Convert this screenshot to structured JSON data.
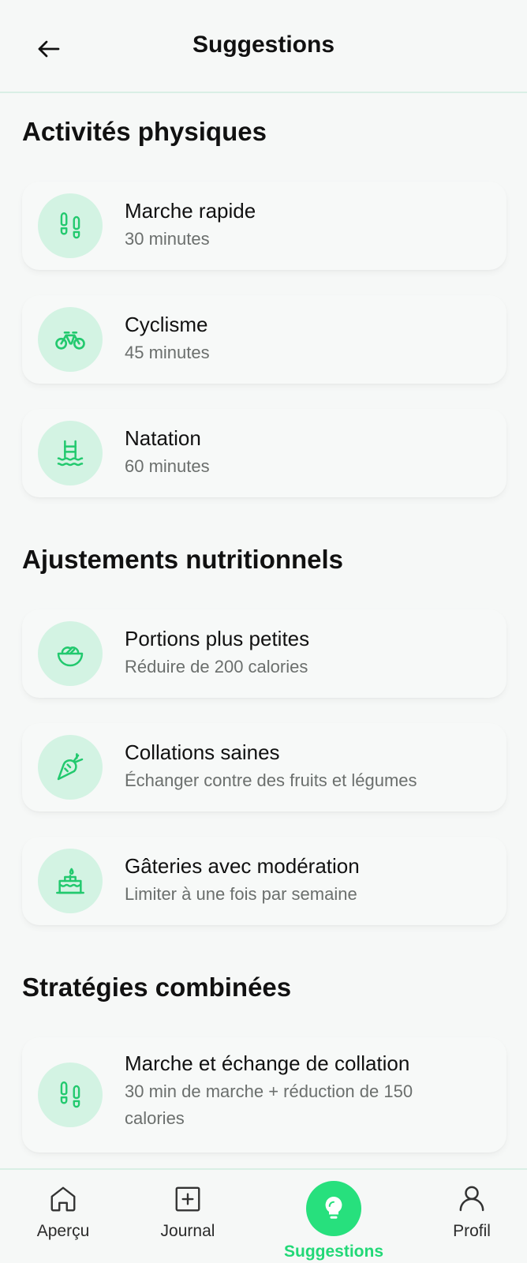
{
  "header": {
    "title": "Suggestions",
    "back_icon": "arrow-left-icon"
  },
  "sections": [
    {
      "title": "Activités physiques",
      "items": [
        {
          "icon": "footprints-icon",
          "title": "Marche rapide",
          "subtitle": "30 minutes"
        },
        {
          "icon": "bicycle-icon",
          "title": "Cyclisme",
          "subtitle": "45 minutes"
        },
        {
          "icon": "pool-icon",
          "title": "Natation",
          "subtitle": "60 minutes"
        }
      ]
    },
    {
      "title": "Ajustements nutritionnels",
      "items": [
        {
          "icon": "salad-bowl-icon",
          "title": "Portions plus petites",
          "subtitle": "Réduire de 200 calories"
        },
        {
          "icon": "carrot-icon",
          "title": "Collations saines",
          "subtitle": "Échanger contre des fruits et légumes"
        },
        {
          "icon": "cake-icon",
          "title": "Gâteries avec modération",
          "subtitle": "Limiter à une fois par semaine"
        }
      ]
    },
    {
      "title": "Stratégies combinées",
      "items": [
        {
          "icon": "footprints-icon",
          "title": "Marche et échange de collation",
          "subtitle": "30 min de marche + réduction de 150 calories"
        }
      ]
    }
  ],
  "nav": [
    {
      "label": "Aperçu",
      "icon": "home-icon",
      "active": false
    },
    {
      "label": "Journal",
      "icon": "plus-square-icon",
      "active": false
    },
    {
      "label": "Suggestions",
      "icon": "lightbulb-icon",
      "active": true
    },
    {
      "label": "Profil",
      "icon": "user-icon",
      "active": false
    }
  ],
  "colors": {
    "accent": "#27e07d",
    "icon_bg": "#d3f3e3",
    "icon_stroke": "#22c96e",
    "divider": "#d9efe5"
  }
}
